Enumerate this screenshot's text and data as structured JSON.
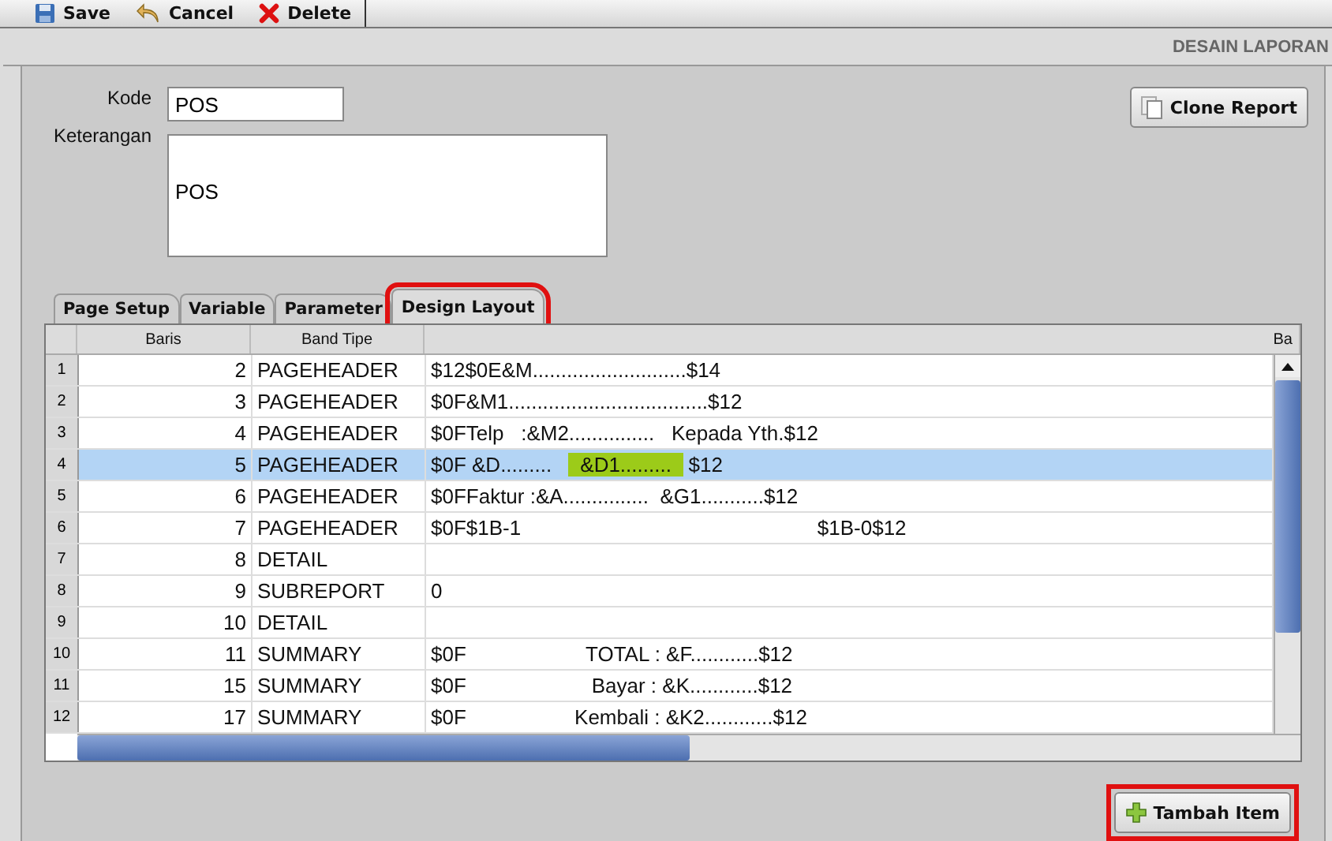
{
  "toolbar": [
    {
      "kind": "save",
      "label": "Save"
    },
    {
      "kind": "cancel",
      "label": "Cancel"
    },
    {
      "kind": "delete",
      "label": "Delete"
    }
  ],
  "header": {
    "title": "DESAIN LAPORAN"
  },
  "form": {
    "kode_label": "Kode",
    "kode_value": "POS",
    "keterangan_label": "Keterangan",
    "keterangan_value": "POS",
    "clone_button": "Clone Report"
  },
  "tabs": [
    {
      "label": "Page Setup",
      "selected": false,
      "annotated": false
    },
    {
      "label": "Variable",
      "selected": false,
      "annotated": false
    },
    {
      "label": "Parameter",
      "selected": false,
      "annotated": false
    },
    {
      "label": "Design Layout",
      "selected": true,
      "annotated": true
    }
  ],
  "table": {
    "columns": [
      "Baris",
      "Band Tipe",
      "Ba"
    ],
    "rows": [
      {
        "index": "1",
        "baris": "2",
        "band": "PAGEHEADER",
        "selected": false,
        "content": [
          {
            "text": "$12$0E&M...........................$14",
            "highlighted": false
          }
        ]
      },
      {
        "index": "2",
        "baris": "3",
        "band": "PAGEHEADER",
        "selected": false,
        "content": [
          {
            "text": "$0F&M1...................................$12",
            "highlighted": false
          }
        ]
      },
      {
        "index": "3",
        "baris": "4",
        "band": "PAGEHEADER",
        "selected": false,
        "content": [
          {
            "text": "$0FTelp   :&M2...............   Kepada Yth.$12",
            "highlighted": false
          }
        ]
      },
      {
        "index": "4",
        "baris": "5",
        "band": "PAGEHEADER",
        "selected": true,
        "content": [
          {
            "text": "$0F &D.........   ",
            "highlighted": false
          },
          {
            "text": "  &D1.........  ",
            "highlighted": true
          },
          {
            "text": " $12",
            "highlighted": false
          }
        ]
      },
      {
        "index": "5",
        "baris": "6",
        "band": "PAGEHEADER",
        "selected": false,
        "content": [
          {
            "text": "$0FFaktur :&A...............  &G1...........$12",
            "highlighted": false
          }
        ]
      },
      {
        "index": "6",
        "baris": "7",
        "band": "PAGEHEADER",
        "selected": false,
        "content": [
          {
            "text": "$0F$1B-1                                                    $1B-0$12",
            "highlighted": false
          }
        ]
      },
      {
        "index": "7",
        "baris": "8",
        "band": "DETAIL",
        "selected": false,
        "content": []
      },
      {
        "index": "8",
        "baris": "9",
        "band": "SUBREPORT",
        "selected": false,
        "content": [
          {
            "text": "0",
            "highlighted": false
          }
        ]
      },
      {
        "index": "9",
        "baris": "10",
        "band": "DETAIL",
        "selected": false,
        "content": []
      },
      {
        "index": "10",
        "baris": "11",
        "band": "SUMMARY",
        "selected": false,
        "content": [
          {
            "text": "$0F                     TOTAL : &F............$12",
            "highlighted": false
          }
        ]
      },
      {
        "index": "11",
        "baris": "15",
        "band": "SUMMARY",
        "selected": false,
        "content": [
          {
            "text": "$0F                      Bayar : &K............$12",
            "highlighted": false
          }
        ]
      },
      {
        "index": "12",
        "baris": "17",
        "band": "SUMMARY",
        "selected": false,
        "content": [
          {
            "text": "$0F                   Kembali : &K2............$12",
            "highlighted": false
          }
        ]
      }
    ]
  },
  "add_button": {
    "label": "Tambah Item",
    "annotated": true
  }
}
